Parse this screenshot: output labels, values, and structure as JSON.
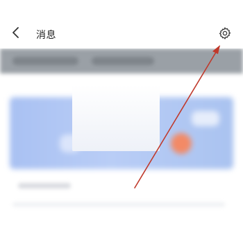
{
  "header": {
    "title": "消息",
    "back_icon": "chevron-left-icon",
    "settings_icon": "gear-icon"
  },
  "colors": {
    "annotation_arrow": "#c0392b",
    "banner": "#b3c8f4",
    "tab_bar": "#9aa0a6"
  }
}
